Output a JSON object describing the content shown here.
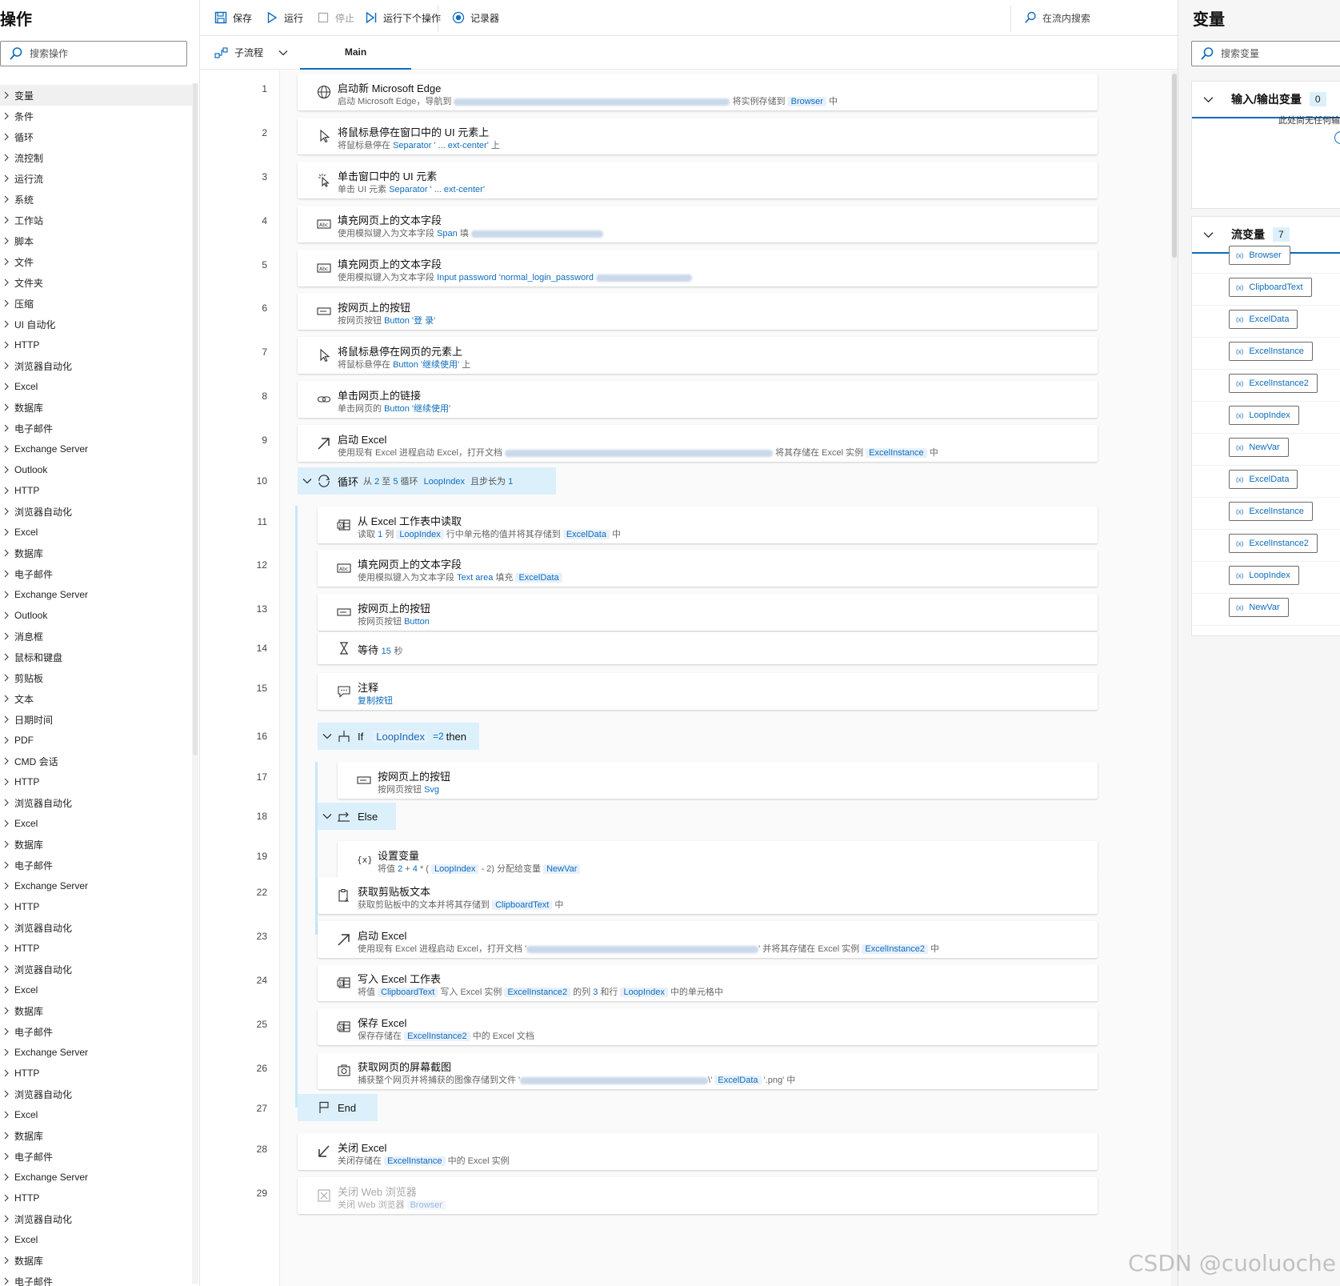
{
  "actions_panel": {
    "title": "操作",
    "search_placeholder": "搜索操作",
    "categories": [
      "变量",
      "条件",
      "循环",
      "流控制",
      "运行流",
      "系统",
      "工作站",
      "脚本",
      "文件",
      "文件夹",
      "压缩",
      "UI 自动化",
      "HTTP",
      "浏览器自动化",
      "Excel",
      "数据库",
      "电子邮件",
      "Exchange Server",
      "Outlook",
      "HTTP",
      "浏览器自动化",
      "Excel",
      "数据库",
      "电子邮件",
      "Exchange Server",
      "Outlook",
      "消息框",
      "鼠标和键盘",
      "剪贴板",
      "文本",
      "日期时间",
      "PDF",
      "CMD 会话",
      "HTTP",
      "浏览器自动化",
      "Excel",
      "数据库",
      "电子邮件",
      "Exchange Server",
      "HTTP",
      "浏览器自动化",
      "HTTP",
      "浏览器自动化",
      "Excel",
      "数据库",
      "电子邮件",
      "Exchange Server",
      "HTTP",
      "浏览器自动化",
      "Excel",
      "数据库",
      "电子邮件",
      "Exchange Server",
      "HTTP",
      "浏览器自动化",
      "Excel",
      "数据库",
      "电子邮件"
    ]
  },
  "toolbar": {
    "save": "保存",
    "run": "运行",
    "stop": "停止",
    "run_next": "运行下个操作",
    "recorder": "记录器",
    "flow_search": "在流内搜索"
  },
  "tabs": {
    "subflows": "子流程",
    "main": "Main"
  },
  "flow": {
    "s1": {
      "num": "1",
      "title": "启动新 Microsoft Edge",
      "d1": "启动 Microsoft Edge，导航到",
      "d2": "将实例存储到",
      "v1": "Browser",
      "d3": "中"
    },
    "s2": {
      "num": "2",
      "title": "将鼠标悬停在窗口中的 UI 元素上",
      "d1": "将鼠标悬停在",
      "t1": "Separator ' ... ext-center'",
      "d2": "上"
    },
    "s3": {
      "num": "3",
      "title": "单击窗口中的 UI 元素",
      "d1": "单击 UI 元素",
      "t1": "Separator ' ... ext-center'"
    },
    "s4": {
      "num": "4",
      "title": "填充网页上的文本字段",
      "d1": "使用模拟键入为文本字段",
      "t1": "Span",
      "d2": "填"
    },
    "s5": {
      "num": "5",
      "title": "填充网页上的文本字段",
      "d1": "使用模拟键入为文本字段",
      "t1": "Input password 'normal_login_password"
    },
    "s6": {
      "num": "6",
      "title": "按网页上的按钮",
      "d1": "按网页按钮",
      "t1": "Button '登 录'"
    },
    "s7": {
      "num": "7",
      "title": "将鼠标悬停在网页的元素上",
      "d1": "将鼠标悬停在",
      "t1": "Button '继续使用'",
      "d2": "上"
    },
    "s8": {
      "num": "8",
      "title": "单击网页上的链接",
      "d1": "单击网页的",
      "t1": "Button '继续使用'"
    },
    "s9": {
      "num": "9",
      "title": "启动 Excel",
      "d1": "使用现有 Excel 进程启动 Excel，打开文档",
      "d2": "将其存储在 Excel 实例",
      "v1": "ExcelInstance",
      "d3": "中"
    },
    "s10": {
      "num": "10",
      "title": "循环",
      "d1": "从",
      "n1": "2",
      "d2": "至",
      "n2": "5",
      "d3": "循环",
      "v1": "LoopIndex",
      "d4": "且步长为",
      "n3": "1"
    },
    "s11": {
      "num": "11",
      "title": "从 Excel 工作表中读取",
      "d1": "读取",
      "n1": "1",
      "d2": "列",
      "v1": "LoopIndex",
      "d3": "行中单元格的值并将其存储到",
      "v2": "ExcelData",
      "d4": "中"
    },
    "s12": {
      "num": "12",
      "title": "填充网页上的文本字段",
      "d1": "使用模拟键入为文本字段",
      "t1": "Text area",
      "d2": "填充",
      "v1": "ExcelData"
    },
    "s13": {
      "num": "13",
      "title": "按网页上的按钮",
      "d1": "按网页按钮",
      "t1": "Button"
    },
    "s14": {
      "num": "14",
      "title": "等待",
      "t1": "15",
      "d1": "秒"
    },
    "s15": {
      "num": "15",
      "title": "注释",
      "t1": "复制按钮"
    },
    "s16": {
      "num": "16",
      "title": "If",
      "v1": "LoopIndex",
      "t1": "=2",
      "d1": "then"
    },
    "s17": {
      "num": "17",
      "title": "按网页上的按钮",
      "d1": "按网页按钮",
      "t1": "Svg"
    },
    "s18": {
      "num": "18",
      "title": "Else"
    },
    "s19": {
      "num": "19",
      "title": "设置变量",
      "d1": "将值",
      "t1": "2",
      "d2": "+",
      "t2": "4",
      "d3": "* (",
      "v1": "LoopIndex",
      "d4": "- 2) 分配给变量",
      "v2": "NewVar"
    },
    "s22": {
      "num": "22",
      "title": "获取剪贴板文本",
      "d1": "获取剪贴板中的文本并将其存储到",
      "v1": "ClipboardText",
      "d2": "中"
    },
    "s23": {
      "num": "23",
      "title": "启动 Excel",
      "d1": "使用现有 Excel 进程启动 Excel，打开文档 '",
      "d2": "' 并将其存储在 Excel 实例",
      "v1": "ExcelInstance2",
      "d3": "中"
    },
    "s24": {
      "num": "24",
      "title": "写入 Excel 工作表",
      "d1": "将值",
      "v1": "ClipboardText",
      "d2": "写入 Excel 实例",
      "v2": "ExcelInstance2",
      "d3": "的列",
      "n1": "3",
      "d4": "和行",
      "v3": "LoopIndex",
      "d5": "中的单元格中"
    },
    "s25": {
      "num": "25",
      "title": "保存 Excel",
      "d1": "保存存储在",
      "v1": "ExcelInstance2",
      "d2": "中的 Excel 文档"
    },
    "s26": {
      "num": "26",
      "title": "获取网页的屏幕截图",
      "d1": "捕获整个网页并将捕获的图像存储到文件 '",
      "d2": "\\'",
      "v1": "ExcelData",
      "d3": "'.png' 中"
    },
    "s27": {
      "num": "27",
      "title": "End"
    },
    "s28": {
      "num": "28",
      "title": "关闭 Excel",
      "d1": "关闭存储在",
      "v1": "ExcelInstance",
      "d2": "中的 Excel 实例"
    },
    "s29": {
      "num": "29",
      "title": "关闭 Web 浏览器",
      "d1": "关闭 Web 浏览器",
      "v1": "Browser"
    }
  },
  "variables_panel": {
    "title": "变量",
    "search_placeholder": "搜索变量",
    "io_section": {
      "title": "输入/输出变量",
      "count": "0",
      "empty_text": "此处尚无任何输"
    },
    "flow_section": {
      "title": "流变量",
      "count": "7"
    },
    "flow_vars": [
      "Browser",
      "ClipboardText",
      "ExcelData",
      "ExcelInstance",
      "ExcelInstance2",
      "LoopIndex",
      "NewVar",
      "ExcelData",
      "ExcelInstance",
      "ExcelInstance2",
      "LoopIndex",
      "NewVar"
    ]
  },
  "watermark": "CSDN @cuoluoche",
  "colors": {
    "accent": "#0f6cbd",
    "block_header": "#dcf0fc",
    "token_bg": "#e8f1fb"
  }
}
